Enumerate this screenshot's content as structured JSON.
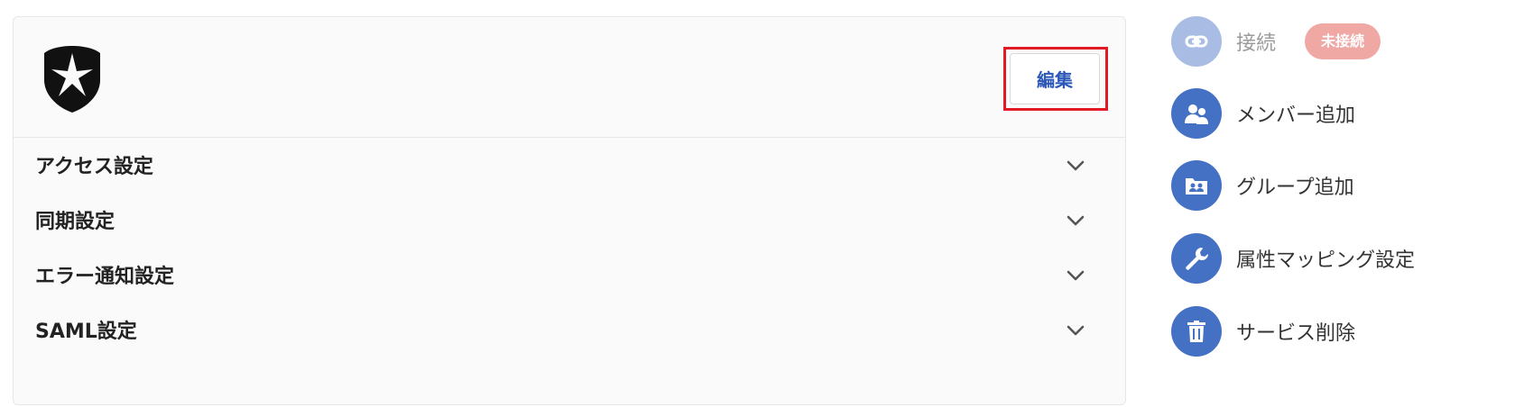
{
  "card": {
    "edit_label": "編集",
    "sections": [
      {
        "label": "アクセス設定"
      },
      {
        "label": "同期設定"
      },
      {
        "label": "エラー通知設定"
      },
      {
        "label": "SAML設定"
      }
    ]
  },
  "actions": [
    {
      "label": "接続",
      "icon": "link-icon",
      "status_badge": "未接続",
      "enabled": false
    },
    {
      "label": "メンバー追加",
      "icon": "users-icon",
      "enabled": true
    },
    {
      "label": "グループ追加",
      "icon": "group-folder-icon",
      "enabled": true
    },
    {
      "label": "属性マッピング設定",
      "icon": "wrench-icon",
      "enabled": true
    },
    {
      "label": "サービス削除",
      "icon": "trash-icon",
      "enabled": true
    }
  ],
  "colors": {
    "accent": "#4571c4",
    "accent_disabled": "#a9bde4",
    "badge_bg": "#f0a8a4",
    "highlight": "#e01b24",
    "edit_text": "#2b57b8"
  }
}
